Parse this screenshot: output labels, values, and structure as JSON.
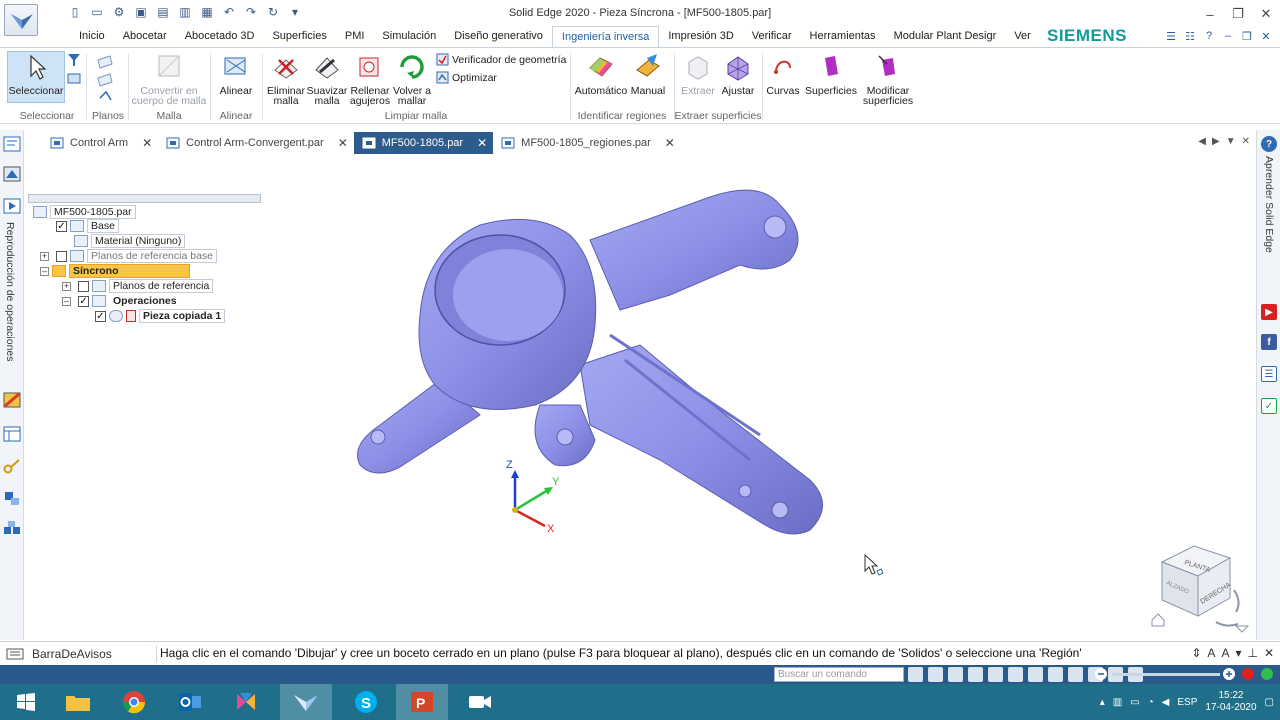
{
  "window": {
    "title": "Solid Edge 2020 - Pieza Síncrona - [MF500-1805.par]"
  },
  "ribbon_tabs": [
    {
      "label": "Inicio"
    },
    {
      "label": "Abocetar"
    },
    {
      "label": "Abocetado 3D"
    },
    {
      "label": "Superficies"
    },
    {
      "label": "PMI"
    },
    {
      "label": "Simulación"
    },
    {
      "label": "Diseño generativo"
    },
    {
      "label": "Ingeniería inversa"
    },
    {
      "label": "Impresión 3D"
    },
    {
      "label": "Verificar"
    },
    {
      "label": "Herramientas"
    },
    {
      "label": "Modular Plant Desigr"
    },
    {
      "label": "Ver"
    }
  ],
  "brand": {
    "name": "SIEMENS",
    "color": "#0e9c9a"
  },
  "ribbon": {
    "select_label": "Seleccionar",
    "select_group": "Seleccionar",
    "planes_group": "Planos",
    "convert_label": "Convertir en cuerpo de malla",
    "mesh_group": "Malla",
    "align_label": "Alinear",
    "align_group": "Alinear",
    "remove_mesh": "Eliminar malla",
    "smooth_mesh": "Suavizar malla",
    "fill_holes": "Rellenar agujeros",
    "remesh": "Volver a mallar",
    "geometry_checker": "Verificador de geometría",
    "optimize": "Optimizar",
    "clean_mesh_group": "Limpiar malla",
    "automatic": "Automático",
    "manual": "Manual",
    "identify_regions_group": "Identificar regiones",
    "extract": "Extraer",
    "adjust": "Ajustar",
    "extract_surfaces_group": "Extraer superficies",
    "curves": "Curvas",
    "surfaces": "Superficies",
    "modify_surfaces": "Modificar superficies"
  },
  "doc_tabs": [
    {
      "label": "Control Arm"
    },
    {
      "label": "Control Arm-Convergent.par"
    },
    {
      "label": "MF500-1805.par"
    },
    {
      "label": "MF500-1805_regiones.par"
    }
  ],
  "left_rail": {
    "label": "Reproducción de operaciones"
  },
  "right_rail": {
    "label": "Aprender Solid Edge"
  },
  "tree": {
    "root": "MF500-1805.par",
    "base": "Base",
    "material": "Material (Ninguno)",
    "base_ref_planes": "Planos de referencia base",
    "synchronous": "Síncrono",
    "ref_planes": "Planos de referencia",
    "operations": "Operaciones",
    "copied_part": "Pieza copiada 1"
  },
  "triad": {
    "x": "X",
    "y": "Y",
    "z": "Z"
  },
  "viewcube": {
    "top": "PLANTA",
    "right": "DERECHA",
    "front": "ALZADO"
  },
  "prompt": {
    "title": "BarraDeAvisos",
    "text": "Haga clic en el comando 'Dibujar' y cree un boceto cerrado en un plano (pulse F3 para bloquear al plano), después clic en un comando de 'Solidos' o seleccione una 'Región'"
  },
  "status": {
    "search_placeholder": "Buscar un comando"
  },
  "taskbar": {
    "lang": "ESP",
    "time": "15:22",
    "date": "17-04-2020"
  },
  "colors": {
    "part": "#8c8fe6",
    "accent": "#2c5b8c",
    "highlight": "#f8c54a",
    "taskbar": "#1f6f8a"
  }
}
